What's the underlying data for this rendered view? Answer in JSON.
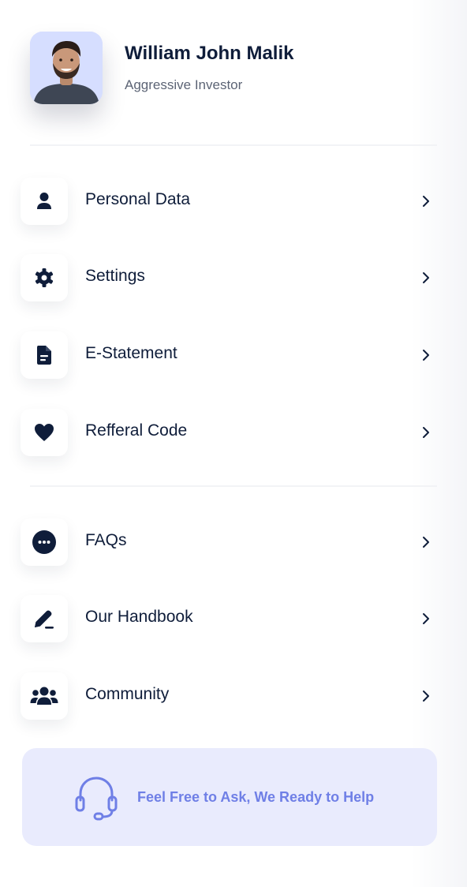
{
  "profile": {
    "name": "William John Malik",
    "role": "Aggressive Investor"
  },
  "menu": {
    "account": [
      {
        "label": "Personal Data",
        "icon": "user-icon"
      },
      {
        "label": "Settings",
        "icon": "gear-icon"
      },
      {
        "label": "E-Statement",
        "icon": "document-icon"
      },
      {
        "label": "Refferal Code",
        "icon": "heart-icon"
      }
    ],
    "support": [
      {
        "label": "FAQs",
        "icon": "more-dots-icon"
      },
      {
        "label": "Our Handbook",
        "icon": "pen-icon"
      },
      {
        "label": "Community",
        "icon": "users-icon"
      }
    ]
  },
  "help": {
    "text": "Feel Free to Ask, We Ready to Help",
    "icon": "headset-icon"
  },
  "colors": {
    "primary": "#0f1d3a",
    "accent": "#6f7fe6",
    "card_bg": "#e9ebfd"
  }
}
